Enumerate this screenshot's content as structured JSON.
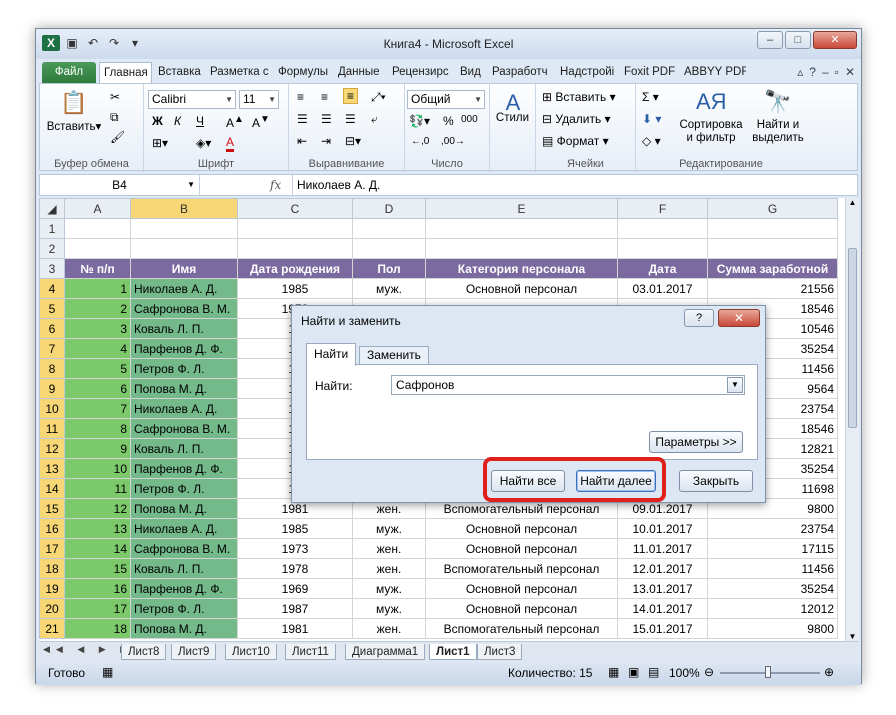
{
  "window": {
    "title": "Книга4 - Microsoft Excel",
    "qat_icons": [
      "excel-logo-icon",
      "save-icon",
      "undo-icon",
      "redo-icon",
      "customize-icon"
    ]
  },
  "ribbon_tabs": [
    "Файл",
    "Главная",
    "Вставка",
    "Разметка с",
    "Формулы",
    "Данные",
    "Рецензирс",
    "Вид",
    "Разработч",
    "Надстройі",
    "Foxit PDF",
    "ABBYY PDF"
  ],
  "ribbon": {
    "clipboard": {
      "paste": "Вставить",
      "label": "Буфер обмена"
    },
    "font": {
      "name": "Calibri",
      "size": "11",
      "bold": "Ж",
      "italic": "К",
      "underline": "Ч",
      "color_letter": "А",
      "label": "Шрифт"
    },
    "alignment": {
      "label": "Выравнивание"
    },
    "number": {
      "format": "Общий",
      "percent": "%",
      "thousands": "000",
      "label": "Число"
    },
    "styles": {
      "label": "Стили"
    },
    "cells": {
      "insert": "Вставить",
      "delete": "Удалить",
      "format": "Формат",
      "label": "Ячейки"
    },
    "editing": {
      "sort": "Сортировка\nи фильтр",
      "find": "Найти и\nвыделить",
      "label": "Редактирование"
    }
  },
  "formula_bar": {
    "name_box": "B4",
    "fx": "fx",
    "value": "Николаев А. Д."
  },
  "columns": [
    "A",
    "B",
    "C",
    "D",
    "E",
    "F",
    "G"
  ],
  "headers": [
    "№ п/п",
    "Имя",
    "Дата рождения",
    "Пол",
    "Категория персонала",
    "Дата",
    "Сумма заработной"
  ],
  "rows": [
    [
      "1",
      "Николаев А. Д.",
      "1985",
      "муж.",
      "Основной персонал",
      "03.01.2017",
      "21556"
    ],
    [
      "2",
      "Сафронова В. М.",
      "1973",
      "",
      "",
      "",
      "18546"
    ],
    [
      "3",
      "Коваль Л. П.",
      "19",
      "",
      "",
      "",
      "10546"
    ],
    [
      "4",
      "Парфенов Д. Ф.",
      "19",
      "",
      "",
      "",
      "35254"
    ],
    [
      "5",
      "Петров Ф. Л.",
      "19",
      "",
      "",
      "",
      "11456"
    ],
    [
      "6",
      "Попова М. Д.",
      "19",
      "",
      "",
      "",
      "9564"
    ],
    [
      "7",
      "Николаев А. Д.",
      "19",
      "",
      "",
      "",
      "23754"
    ],
    [
      "8",
      "Сафронова В. М.",
      "19",
      "",
      "",
      "",
      "18546"
    ],
    [
      "9",
      "Коваль Л. П.",
      "19",
      "",
      "",
      "",
      "12821"
    ],
    [
      "10",
      "Парфенов Д. Ф.",
      "19",
      "",
      "",
      "",
      "35254"
    ],
    [
      "11",
      "Петров Ф. Л.",
      "19",
      "",
      "",
      "",
      "11698"
    ],
    [
      "12",
      "Попова М. Д.",
      "1981",
      "жен.",
      "Вспомогательный персонал",
      "09.01.2017",
      "9800"
    ],
    [
      "13",
      "Николаев А. Д.",
      "1985",
      "муж.",
      "Основной персонал",
      "10.01.2017",
      "23754"
    ],
    [
      "14",
      "Сафронова В. М.",
      "1973",
      "жен.",
      "Основной персонал",
      "11.01.2017",
      "17115"
    ],
    [
      "15",
      "Коваль Л. П.",
      "1978",
      "жен.",
      "Вспомогательный персонал",
      "12.01.2017",
      "11456"
    ],
    [
      "16",
      "Парфенов Д. Ф.",
      "1969",
      "муж.",
      "Основной персонал",
      "13.01.2017",
      "35254"
    ],
    [
      "17",
      "Петров Ф. Л.",
      "1987",
      "муж.",
      "Основной персонал",
      "14.01.2017",
      "12012"
    ],
    [
      "18",
      "Попова М. Д.",
      "1981",
      "жен.",
      "Вспомогательный персонал",
      "15.01.2017",
      "9800"
    ]
  ],
  "sheets": [
    "Лист8",
    "Лист9",
    "Лист10",
    "Лист11",
    "Диаграмма1",
    "Лист1",
    "Лист3"
  ],
  "active_sheet": "Лист1",
  "status": {
    "ready": "Готово",
    "count": "Количество: 15",
    "zoom": "100%"
  },
  "dialog": {
    "title": "Найти и заменить",
    "help": "?",
    "tab_find": "Найти",
    "tab_replace": "Заменить",
    "find_label": "Найти:",
    "find_value": "Сафронов",
    "params_button": "Параметры >>",
    "find_all": "Найти все",
    "find_next": "Найти далее",
    "close": "Закрыть"
  },
  "colors": {
    "header_bg": "#7b6aa0",
    "col_a_bg": "#7bc96b",
    "col_b_bg": "#73b98a",
    "highlight": "#e0201a"
  }
}
